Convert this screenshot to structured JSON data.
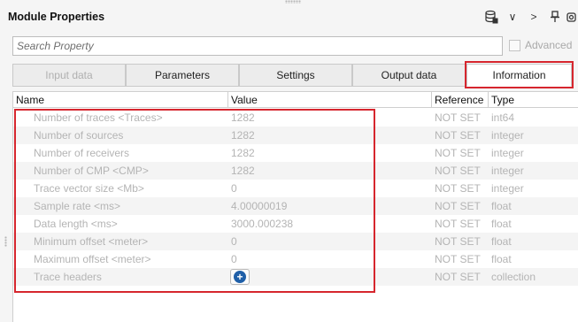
{
  "window": {
    "title": "Module Properties"
  },
  "toolbar": {
    "icons": [
      "database-icon",
      "chevron-down-icon",
      "chevron-right-icon",
      "pin-icon",
      "restore-icon"
    ],
    "chevron_down": "∨",
    "chevron_right": ">"
  },
  "search": {
    "placeholder": "Search Property",
    "value": ""
  },
  "advanced": {
    "label": "Advanced",
    "checked": false,
    "enabled": false
  },
  "tabs": [
    {
      "label": "Input data",
      "enabled": false,
      "active": false
    },
    {
      "label": "Parameters",
      "enabled": true,
      "active": false
    },
    {
      "label": "Settings",
      "enabled": true,
      "active": false
    },
    {
      "label": "Output data",
      "enabled": true,
      "active": false
    },
    {
      "label": "Information",
      "enabled": true,
      "active": true
    }
  ],
  "table": {
    "columns": {
      "name": "Name",
      "value": "Value",
      "reference": "Reference",
      "type": "Type"
    },
    "rows": [
      {
        "name": "Number of traces <Traces>",
        "value": "1282",
        "reference": "NOT SET",
        "type": "int64"
      },
      {
        "name": "Number of sources",
        "value": "1282",
        "reference": "NOT SET",
        "type": "integer"
      },
      {
        "name": "Number of receivers",
        "value": "1282",
        "reference": "NOT SET",
        "type": "integer"
      },
      {
        "name": "Number of CMP <CMP>",
        "value": "1282",
        "reference": "NOT SET",
        "type": "integer"
      },
      {
        "name": "Trace vector size <Mb>",
        "value": "0",
        "reference": "NOT SET",
        "type": "integer"
      },
      {
        "name": "Sample rate <ms>",
        "value": "4.00000019",
        "reference": "NOT SET",
        "type": "float"
      },
      {
        "name": "Data length <ms>",
        "value": "3000.000238",
        "reference": "NOT SET",
        "type": "float"
      },
      {
        "name": "Minimum offset <meter>",
        "value": "0",
        "reference": "NOT SET",
        "type": "float"
      },
      {
        "name": "Maximum offset <meter>",
        "value": "0",
        "reference": "NOT SET",
        "type": "float"
      },
      {
        "name": "Trace headers",
        "value": "",
        "reference": "NOT SET",
        "type": "collection",
        "action": "+"
      }
    ]
  },
  "colors": {
    "highlight": "#d6262e",
    "accent": "#1f5fa8",
    "disabled_text": "#b4b4b4"
  }
}
